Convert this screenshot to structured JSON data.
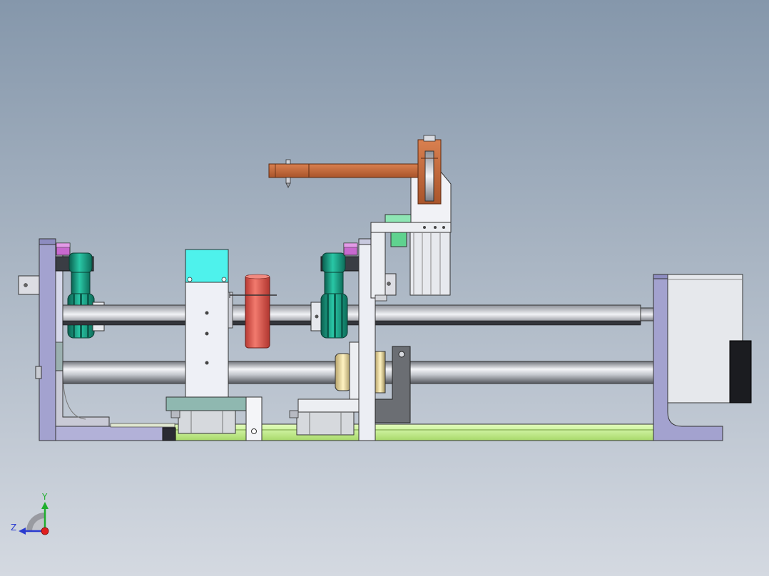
{
  "triad": {
    "y_label": "Y",
    "z_label": "Z"
  },
  "colors": {
    "frame_purple": "#a3a2cf",
    "plate_white": "#e9ebf1",
    "gear_green": "#1ea98e",
    "cyan_block": "#4ef2ec",
    "red_cylinder": "#e26155",
    "arm_orange": "#c46937",
    "lime_rail": "#c8f58e",
    "magenta_block": "#c868cf",
    "motor_gray": "#e6e8ec",
    "axis_red": "#e11e1e",
    "axis_green": "#1fae2d",
    "axis_blue": "#2a3bd0"
  },
  "icons": {
    "triad": "coordinate-triad-icon"
  }
}
